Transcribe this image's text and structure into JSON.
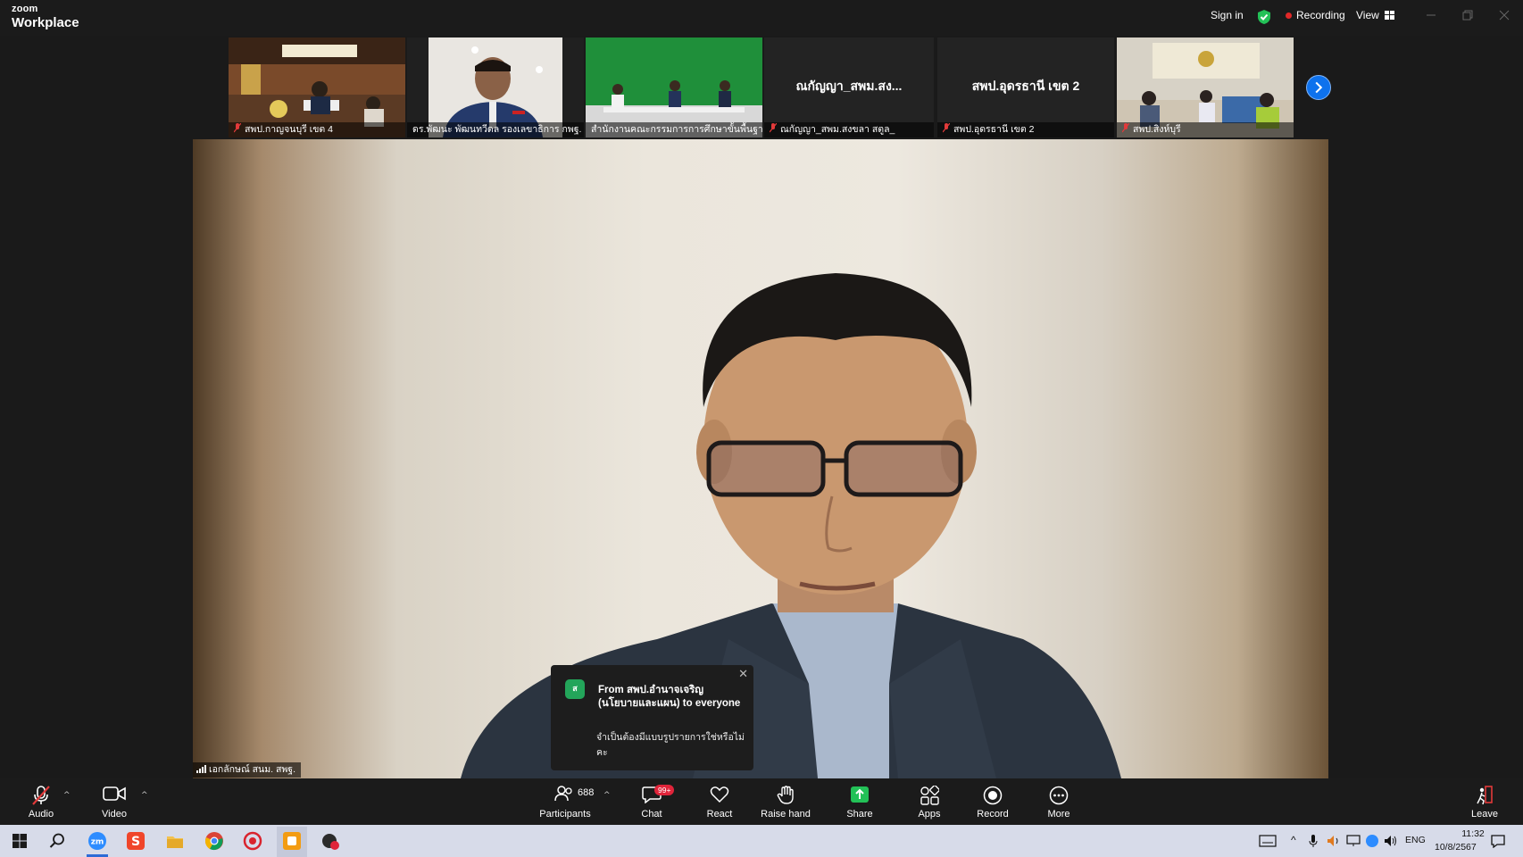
{
  "window": {
    "brand_small": "zoom",
    "brand_large": "Workplace",
    "sign_in": "Sign in",
    "recording": "Recording",
    "view": "View"
  },
  "gallery": {
    "tiles": [
      {
        "name": "สพป.กาญจนบุรี เขต 4",
        "type": "video",
        "muted": true
      },
      {
        "name": "ดร.พัฒนะ พัฒนทวีดล รองเลขาธิการ กพฐ.",
        "type": "video",
        "muted": false
      },
      {
        "name": "สำนักงานคณะกรรมการการศึกษาขั้นพื้นฐาน",
        "type": "video",
        "muted": false
      },
      {
        "name": "ณกัญญา_สพม.สงขลา สตูล_",
        "display": "ณกัญญา_สพม.สง...",
        "type": "name-only",
        "muted": true
      },
      {
        "name": "สพป.อุดรธานี เขต 2",
        "display": "สพป.อุดรธานี เขต 2",
        "type": "name-only",
        "muted": true
      },
      {
        "name": "สพป.สิงห์บุรี",
        "type": "video",
        "muted": true
      }
    ]
  },
  "main_video": {
    "speaker_name": "เอกลักษณ์ สนม. สพฐ."
  },
  "chat_toast": {
    "icon_text": "ส",
    "from": "From สพป.อำนาจเจริญ (นโยบายและแผน) to everyone",
    "message": "จำเป็นต้องมีแบบรูปรายการใช่หรือไม่คะ"
  },
  "toolbar": {
    "audio": "Audio",
    "video": "Video",
    "participants": "Participants",
    "participant_count": "688",
    "chat": "Chat",
    "chat_badge": "99+",
    "react": "React",
    "raise_hand": "Raise hand",
    "share": "Share",
    "apps": "Apps",
    "record": "Record",
    "more": "More",
    "leave": "Leave"
  },
  "taskbar": {
    "apps": [
      "windows-start",
      "search",
      "zoom",
      "scribble",
      "file-explorer",
      "chrome",
      "app-red",
      "app-orange",
      "app-dark"
    ],
    "language": "ENG",
    "time": "11:32",
    "date": "10/8/2567"
  },
  "colors": {
    "accent_blue": "#0e72ed",
    "share_green": "#23c157",
    "recording_red": "#e02828"
  }
}
